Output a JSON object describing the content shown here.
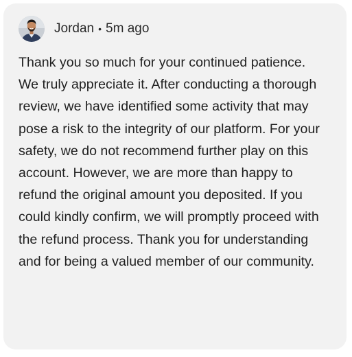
{
  "comment": {
    "author": "Jordan",
    "separator": "•",
    "time": "5m ago",
    "avatar_icon": "user-avatar-photo",
    "body": "Thank you so much for your continued patience. We truly appreciate it. After conducting a thorough review, we have identified some activity that may pose a risk to the integrity of our platform. For your safety, we do not recommend further play on this account. However, we are more than happy to refund the original amount you deposited. If you could kindly confirm, we will promptly proceed with the refund process. Thank you for understanding and for being a valued member of our community."
  },
  "colors": {
    "card_background": "#f2f2f2",
    "text": "#1f1f1f"
  }
}
